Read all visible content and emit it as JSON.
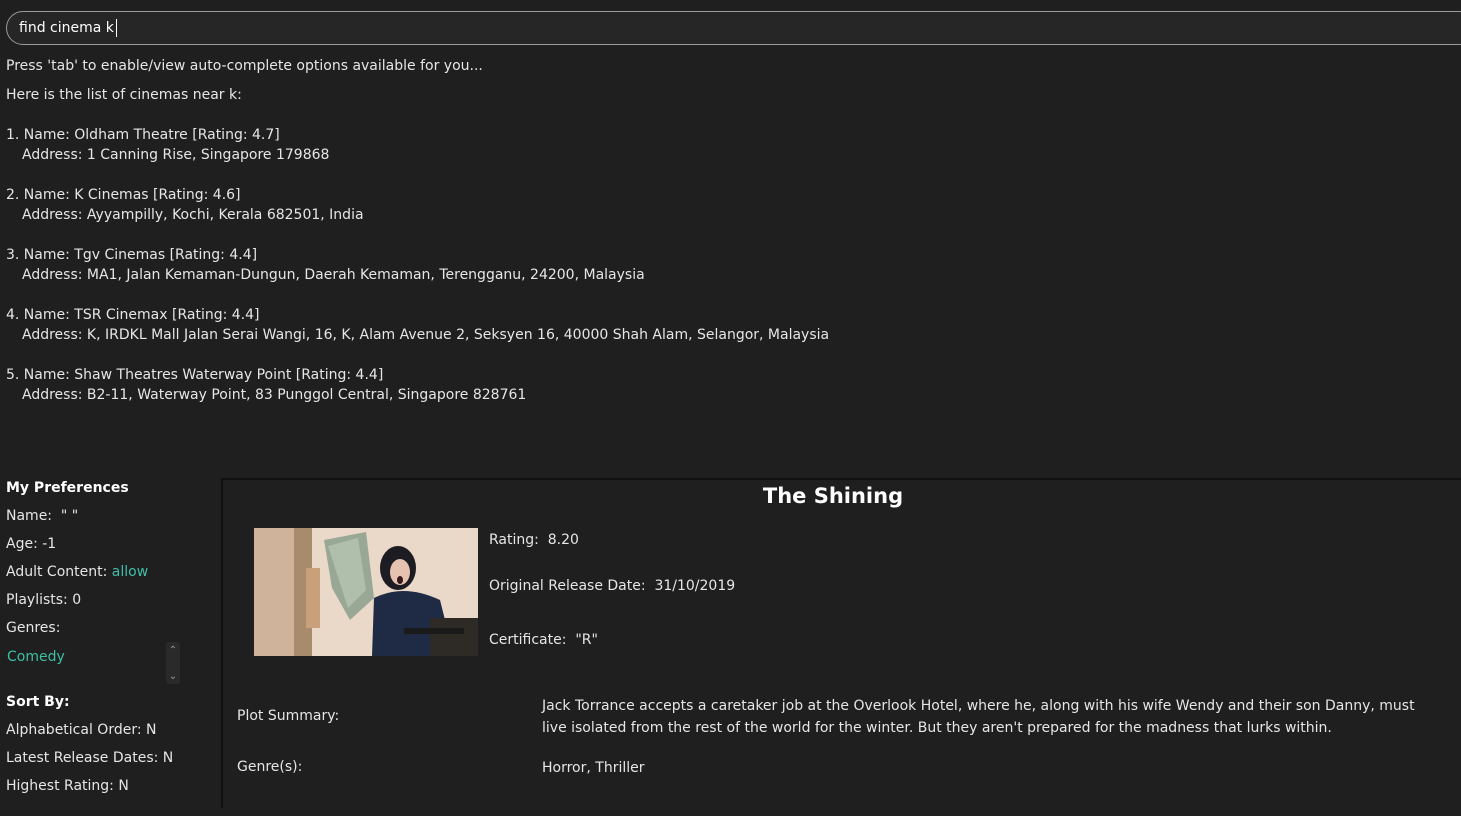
{
  "command": {
    "value": "find cinema k"
  },
  "result": {
    "hint": "Press 'tab' to enable/view auto-complete options available for you...",
    "intro": "Here is the list of cinemas near k:",
    "cinemas": [
      {
        "name_line": "1. Name: Oldham Theatre [Rating: 4.7]",
        "address_line": "Address: 1 Canning Rise, Singapore 179868"
      },
      {
        "name_line": "2. Name: K Cinemas [Rating: 4.6]",
        "address_line": "Address: Ayyampilly, Kochi, Kerala 682501, India"
      },
      {
        "name_line": "3. Name: Tgv Cinemas [Rating: 4.4]",
        "address_line": "Address: MA1, Jalan Kemaman-Dungun, Daerah Kemaman, Terengganu, 24200, Malaysia"
      },
      {
        "name_line": "4. Name: TSR Cinemax [Rating: 4.4]",
        "address_line": "Address: K, IRDKL Mall Jalan Serai Wangi, 16, K, Alam Avenue 2, Seksyen 16, 40000 Shah Alam, Selangor, Malaysia"
      },
      {
        "name_line": "5. Name: Shaw Theatres Waterway Point [Rating: 4.4]",
        "address_line": "Address: B2-11, Waterway Point, 83 Punggol Central, Singapore 828761"
      }
    ]
  },
  "preferences": {
    "heading": "My Preferences",
    "name": "Name:  \" \"",
    "age": "Age: -1",
    "adult_label": "Adult Content: ",
    "adult_value": "allow",
    "playlists": "Playlists: 0",
    "genres_label": "Genres:",
    "genres": [
      "Comedy"
    ]
  },
  "sort": {
    "heading": "Sort By:",
    "alphabetical": "Alphabetical Order: N",
    "latest": "Latest Release Dates: N",
    "highest": "Highest Rating: N"
  },
  "movie": {
    "title": "The Shining",
    "rating": "Rating:  8.20",
    "release": "Original Release Date:  31/10/2019",
    "certificate": "Certificate:  \"R\"",
    "plot_label": "Plot Summary:",
    "plot": "Jack Torrance accepts a caretaker job at the Overlook Hotel, where he, along with his wife Wendy and their son Danny, must live isolated from the rest of the world for the winter. But they aren't prepared for the madness that lurks within.",
    "genre_label": "Genre(s):",
    "genres": "Horror, Thriller"
  },
  "colors": {
    "background": "#1f1f1f",
    "accent": "#3fbfa5"
  }
}
